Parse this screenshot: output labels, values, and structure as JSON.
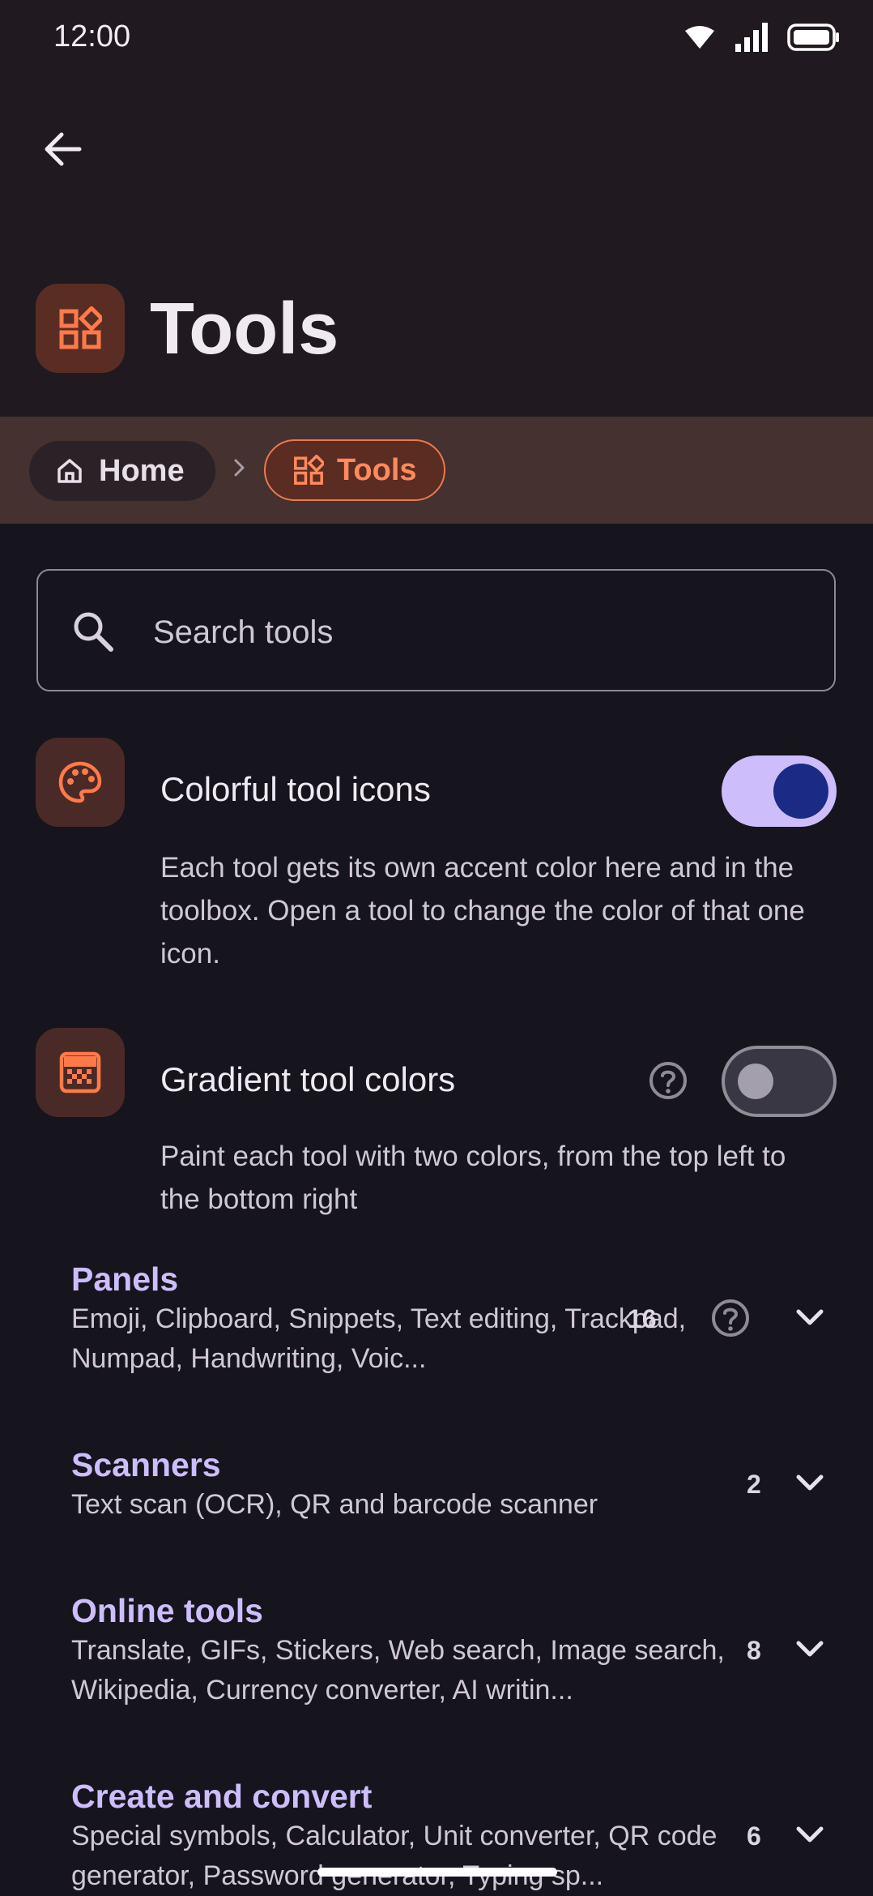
{
  "status_bar": {
    "time": "12:00"
  },
  "header": {
    "title": "Tools"
  },
  "breadcrumb": {
    "home": "Home",
    "current": "Tools"
  },
  "search": {
    "placeholder": "Search tools"
  },
  "settings": [
    {
      "title": "Colorful tool icons",
      "description": "Each tool gets its own accent color here and in the toolbox. Open a tool to change the color of that one icon.",
      "enabled": true
    },
    {
      "title": "Gradient tool colors",
      "description": "Paint each tool with two colors, from the top left to the bottom right",
      "enabled": false
    }
  ],
  "categories": [
    {
      "title": "Panels",
      "description": "Emoji, Clipboard, Snippets, Text editing, Trackpad, Numpad, Handwriting, Voic...",
      "count": "16"
    },
    {
      "title": "Scanners",
      "description": "Text scan (OCR), QR and barcode scanner",
      "count": "2"
    },
    {
      "title": "Online tools",
      "description": "Translate, GIFs, Stickers, Web search, Image search, Wikipedia, Currency converter, AI writin...",
      "count": "8"
    },
    {
      "title": "Create and convert",
      "description": "Special symbols, Calculator, Unit converter, QR code generator, Password generator, Typing sp...",
      "count": "6"
    }
  ],
  "colors": {
    "accent": "#ff8a5c",
    "category_title": "#cdbdfa",
    "toggle_on": "#cdbdfa",
    "toggle_knob": "#1b2a85"
  }
}
